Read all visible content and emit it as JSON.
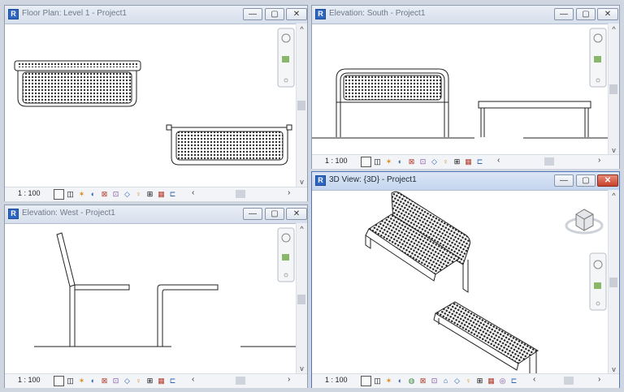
{
  "windows": {
    "floor_plan": {
      "title": "Floor Plan: Level 1 - Project1",
      "scale": "1 : 100"
    },
    "south": {
      "title": "Elevation: South - Project1",
      "scale": "1 : 100"
    },
    "west": {
      "title": "Elevation: West - Project1",
      "scale": "1 : 100"
    },
    "view3d": {
      "title": "3D View: {3D} - Project1",
      "scale": "1 : 100"
    }
  },
  "controls": {
    "minimize": "—",
    "restore": "▢",
    "close": "✕",
    "scroll_left": "‹",
    "scroll_right": "›",
    "scroll_up": "^",
    "scroll_down": "v"
  },
  "toolbar_icons": [
    "detail-level-icon",
    "visual-style-icon",
    "sun-path-icon",
    "shadows-icon",
    "crop-view-icon",
    "show-crop-icon",
    "unlock-3d-icon",
    "temporary-hide-icon",
    "reveal-hidden-icon",
    "worksharing-icon",
    "analytical-model-icon",
    "highlight-displacement-icon"
  ],
  "colors": {
    "active_close": "#c7412a",
    "app_icon": "#2e66c4"
  }
}
